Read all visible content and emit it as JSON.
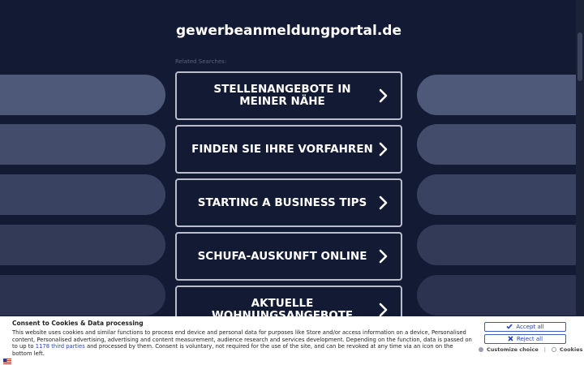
{
  "site": {
    "domain": "gewerbeanmeldungportal.de",
    "related_label": "Related Searches:"
  },
  "links": [
    {
      "label": "STELLENANGEBOTE IN MEINER NÄHE"
    },
    {
      "label": "FINDEN SIE IHRE VORFAHREN"
    },
    {
      "label": "STARTING A BUSINESS TIPS"
    },
    {
      "label": "SCHUFA-AUSKUNFT ONLINE"
    },
    {
      "label": "AKTUELLE WOHNUNGSANGEBOTE"
    }
  ],
  "consent": {
    "title": "Consent to Cookies & Data processing",
    "text_before_link": "This website uses cookies and similar functions to process end device and personal data for purposes like Store and/or access information on a device, Personalised content, Personalised advertising, advertising and content measurement, audience research and services development. Depending on the function, data is passed on to up to ",
    "link_text": "1178 third parties",
    "text_after_link": " and processed by them. Consent is voluntary, not required for the use of the site, and can be revoked at any time via an icon on the bottom left.",
    "accept_label": "Accept all",
    "reject_label": "Reject all",
    "customize_label": "Customize choice",
    "separator": "|",
    "cookies_label": "Cookies"
  },
  "colors": {
    "background": "#131a33",
    "button_border": "#b9bdcc",
    "consent_accent": "#2645b8"
  },
  "icons": {
    "chevron": "chevron-right-icon",
    "accept": "check-icon",
    "reject": "x-icon",
    "flag": "us-flag-icon"
  }
}
